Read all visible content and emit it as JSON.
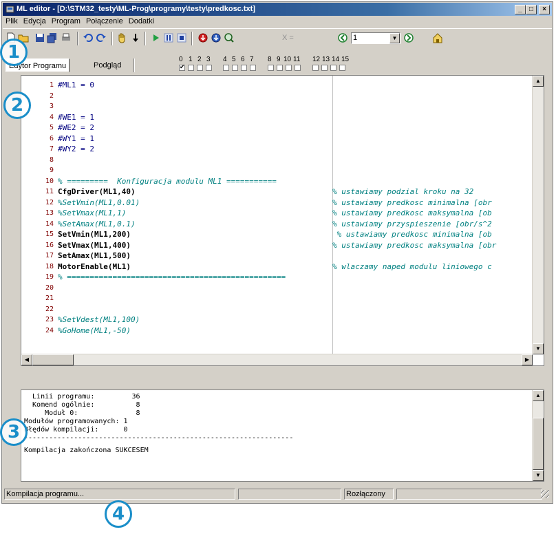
{
  "window": {
    "title": "ML editor - [D:\\STM32_testy\\ML-Prog\\programy\\testy\\predkosc.txt]",
    "minimize": "_",
    "maximize": "□",
    "close": "×"
  },
  "menu": [
    "Plik",
    "Edycja",
    "Program",
    "Połączenie",
    "Dodatki"
  ],
  "toolbar": {
    "x_label": "X =",
    "line_value": "1",
    "icons": [
      "new-file-icon",
      "open-folder-icon",
      "save-icon",
      "save-all-icon",
      "print-icon",
      "undo-icon",
      "redo-icon",
      "hand-icon",
      "step-down-icon",
      "play-icon",
      "pause-icon",
      "stop-icon",
      "record-red-icon",
      "download-blue-icon",
      "search-icon",
      "nav-back-icon",
      "nav-forward-icon",
      "home-icon"
    ]
  },
  "tabs": [
    "Edytor Programu",
    "Podgląd"
  ],
  "channels": [
    "0",
    "1",
    "2",
    "3",
    "4",
    "5",
    "6",
    "7",
    "8",
    "9",
    "10",
    "11",
    "12",
    "13",
    "14",
    "15"
  ],
  "code": [
    {
      "n": "1",
      "t": "#ML1 = 0",
      "c": ""
    },
    {
      "n": "2",
      "t": "",
      "c": ""
    },
    {
      "n": "3",
      "t": "",
      "c": ""
    },
    {
      "n": "4",
      "t": "#WE1 = 1",
      "c": ""
    },
    {
      "n": "5",
      "t": "#WE2 = 2",
      "c": ""
    },
    {
      "n": "6",
      "t": "#WY1 = 1",
      "c": ""
    },
    {
      "n": "7",
      "t": "#WY2 = 2",
      "c": ""
    },
    {
      "n": "8",
      "t": "",
      "c": ""
    },
    {
      "n": "9",
      "t": "",
      "c": ""
    },
    {
      "n": "10",
      "t": "% =========  Konfiguracja modulu ML1 ===========",
      "c": ""
    },
    {
      "n": "11",
      "t": "CfgDriver(ML1,40)",
      "c": "% ustawiamy podzial kroku na 32"
    },
    {
      "n": "12",
      "t": "%SetVmin(ML1,0.01)",
      "c": "% ustawiamy predkosc minimalna [obr"
    },
    {
      "n": "13",
      "t": "%SetVmax(ML1,1)",
      "c": "% ustawiamy predkosc maksymalna [ob"
    },
    {
      "n": "14",
      "t": "%SetAmax(ML1,0.1)",
      "c": "% ustawiamy przyspieszenie [obr/s^2"
    },
    {
      "n": "15",
      "t": "SetVmin(ML1,200)",
      "c": " % ustawiamy predkosc minimalna [ob"
    },
    {
      "n": "16",
      "t": "SetVmax(ML1,400)",
      "c": "% ustawiamy predkosc maksymalna [obr"
    },
    {
      "n": "17",
      "t": "SetAmax(ML1,500)",
      "c": ""
    },
    {
      "n": "18",
      "t": "MotorEnable(ML1)",
      "c": "% wlaczamy naped modulu liniowego c"
    },
    {
      "n": "19",
      "t": "% ================================================",
      "c": ""
    },
    {
      "n": "20",
      "t": "",
      "c": ""
    },
    {
      "n": "21",
      "t": "",
      "c": ""
    },
    {
      "n": "22",
      "t": "",
      "c": ""
    },
    {
      "n": "23",
      "t": "%SetVdest(ML1,100)",
      "c": ""
    },
    {
      "n": "24",
      "t": "%GoHome(ML1,-50)",
      "c": ""
    }
  ],
  "output": [
    "  Linii programu:         36",
    "  Komend ogólnie:          8",
    "     Moduł 0:              8",
    "Modułów programowanych: 1",
    "Błędów kompilacji:      0",
    "-----------------------------------------------------------------",
    "Kompilacja zakończona SUKCESEM"
  ],
  "status": {
    "left": "Kompilacja programu...",
    "middle": "",
    "connection": "Rozłączony",
    "right": ""
  },
  "callouts": [
    "1",
    "2",
    "3",
    "4"
  ]
}
